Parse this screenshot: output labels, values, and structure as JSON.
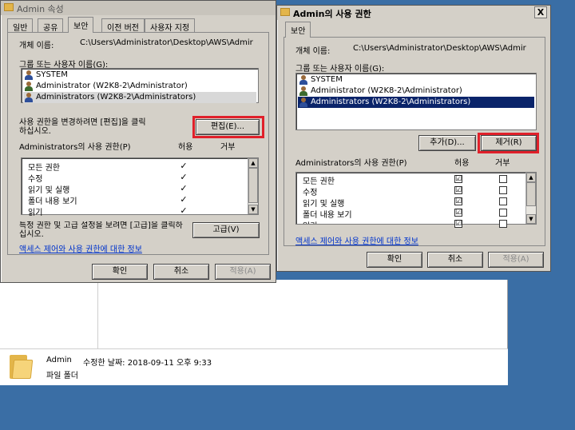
{
  "explorer": {
    "folder_name": "Admin",
    "modified": "수정한 날짜: 2018-09-11 오후 9:33",
    "type": "파일 폴더"
  },
  "props": {
    "title": "Admin 속성",
    "tabs": [
      "일반",
      "공유",
      "보안",
      "이전 버전",
      "사용자 지정"
    ],
    "object_label": "개체 이름:",
    "object_value": "C:\\Users\\Administrator\\Desktop\\AWS\\Admir",
    "groups_label": "그룹 또는 사용자 이름(G):",
    "users": [
      "SYSTEM",
      "Administrator (W2K8-2\\Administrator)",
      "Administrators (W2K8-2\\Administrators)"
    ],
    "change_text": "사용 권한을 변경하려면 [편집]을 클릭하십시오.",
    "edit_button": "편집(E)...",
    "perm_header": "Administrators의 사용 권한(P)",
    "allow": "허용",
    "deny": "거부",
    "perms": [
      "모든 권한",
      "수정",
      "읽기 및 실행",
      "폴더 내용 보기",
      "읽기"
    ],
    "perm_check": "✓",
    "adv_text": "특정 권한 및 고급 설정을 보려면 [고급]을 클릭하십시오.",
    "adv_button": "고급(V)",
    "link": "액세스 제어와 사용 권한에 대한 정보",
    "ok": "확인",
    "cancel": "취소",
    "apply": "적용(A)"
  },
  "perm_dialog": {
    "title": "Admin의 사용 권한",
    "tab": "보안",
    "object_label": "개체 이름:",
    "object_value": "C:\\Users\\Administrator\\Desktop\\AWS\\Admir",
    "groups_label": "그룹 또는 사용자 이름(G):",
    "users": [
      "SYSTEM",
      "Administrator (W2K8-2\\Administrator)",
      "Administrators (W2K8-2\\Administrators)"
    ],
    "add_button": "추가(D)...",
    "remove_button": "제거(R)",
    "perm_header": "Administrators의 사용 권한(P)",
    "allow": "허용",
    "deny": "거부",
    "perms": [
      "모든 권한",
      "수정",
      "읽기 및 실행",
      "폴더 내용 보기",
      "읽기"
    ],
    "allow_mark": "☑",
    "link": "액세스 제어와 사용 권한에 대한 정보",
    "ok": "확인",
    "cancel": "취소",
    "apply": "적용(A)",
    "close": "X"
  },
  "colors": {
    "highlight": "#e0202a",
    "selection": "#0a246a",
    "desktop": "#3a6ea5",
    "link": "#0033cc"
  }
}
